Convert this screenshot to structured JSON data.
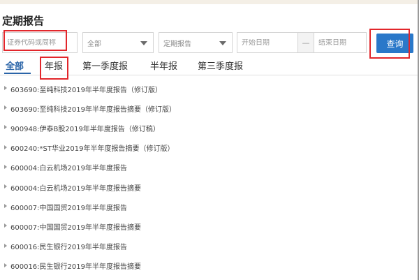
{
  "page": {
    "title": "定期报告"
  },
  "filters": {
    "code_placeholder": "证券代码或简称",
    "exchange_value": "全部",
    "report_type_value": "定期报告",
    "start_date_placeholder": "开始日期",
    "range_separator": "—",
    "end_date_placeholder": "结束日期",
    "query_label": "查询"
  },
  "tabs": [
    {
      "label": "全部",
      "active": true
    },
    {
      "label": "年报",
      "active": false
    },
    {
      "label": "第一季度报",
      "active": false
    },
    {
      "label": "半年报",
      "active": false
    },
    {
      "label": "第三季度报",
      "active": false
    }
  ],
  "reports": [
    "603690:至纯科技2019年半年度报告（修订版）",
    "603690:至纯科技2019年半年度报告摘要（修订版）",
    "900948:伊泰B股2019年半年度报告（修订稿）",
    "600240:*ST华业2019年半年度报告摘要（修订版）",
    "600004:白云机场2019年半年度报告",
    "600004:白云机场2019年半年度报告摘要",
    "600007:中国国贸2019年半年度报告",
    "600007:中国国贸2019年半年度报告摘要",
    "600016:民生银行2019年半年度报告",
    "600016:民生银行2019年半年度报告摘要"
  ],
  "colors": {
    "accent": "#2a78c9",
    "highlight": "#e2262b",
    "active_tab": "#2a64a8"
  }
}
